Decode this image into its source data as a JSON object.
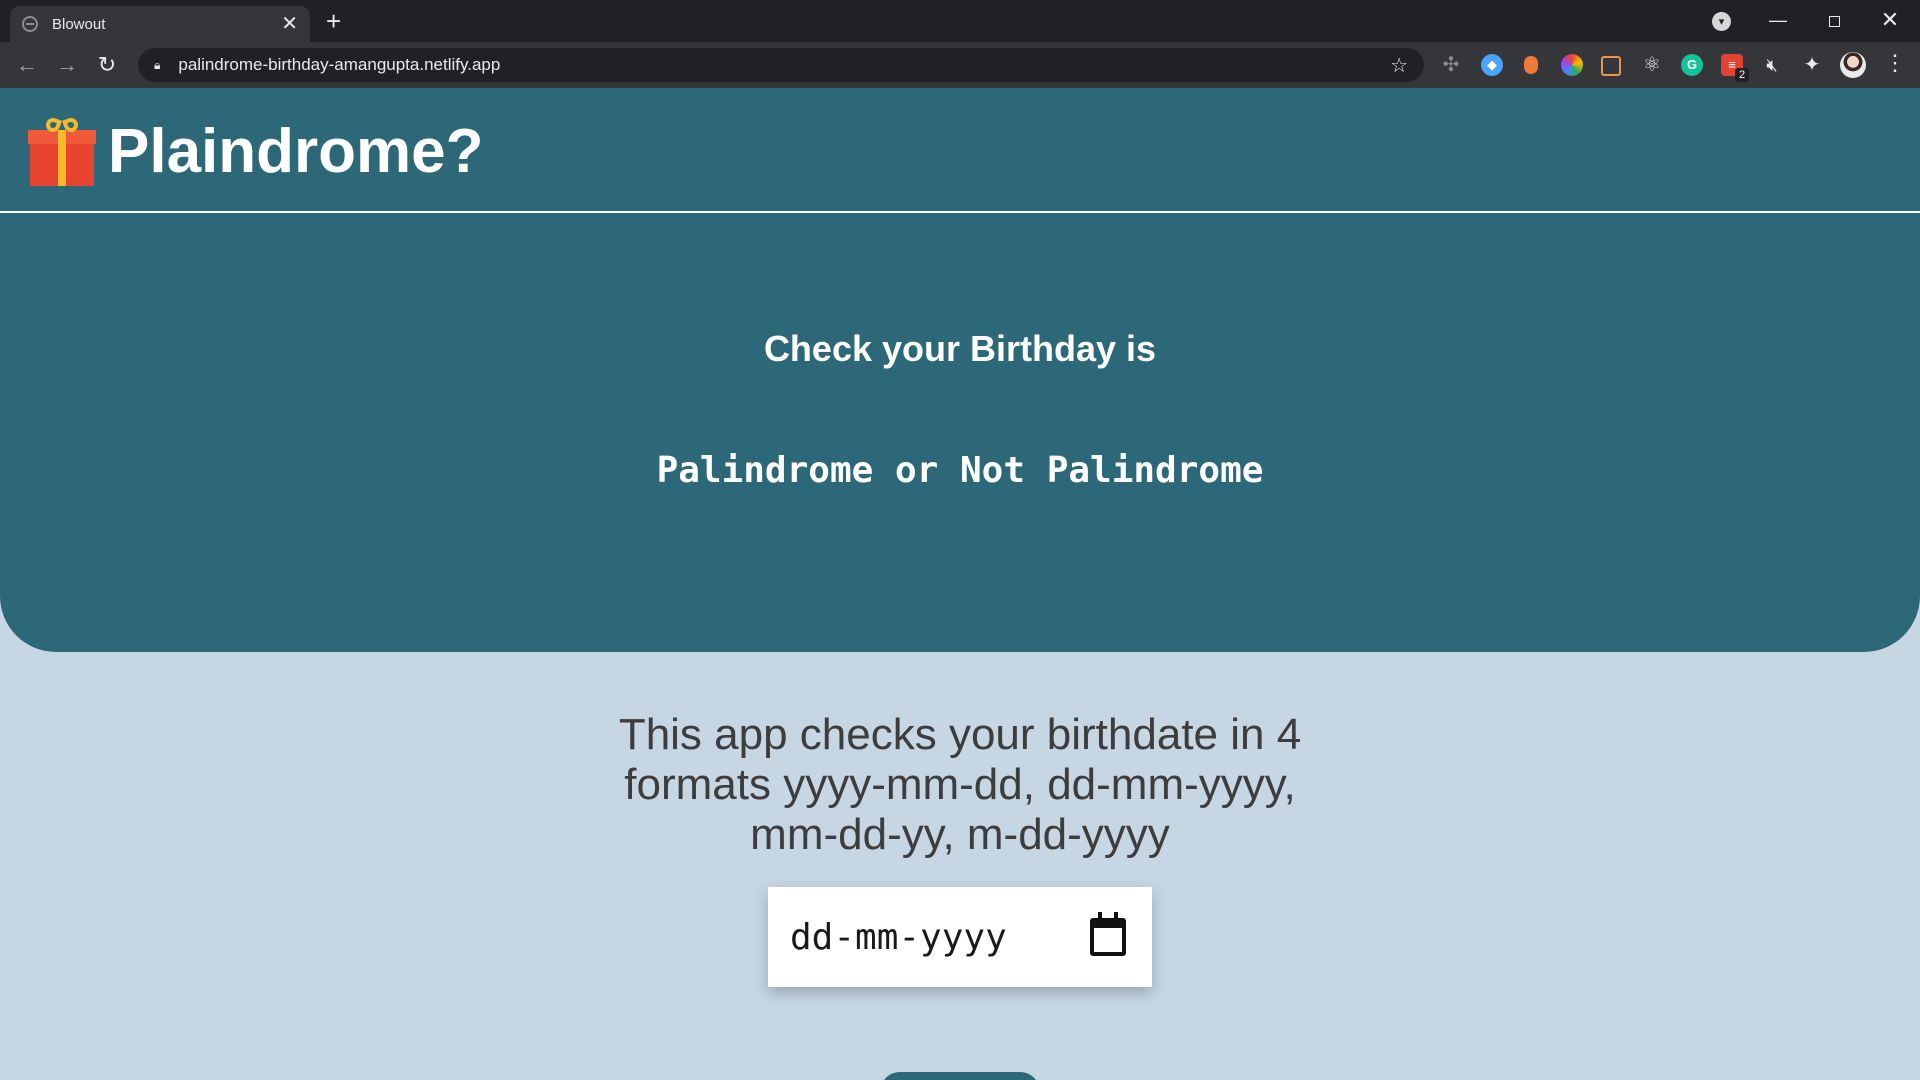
{
  "browser": {
    "tab": {
      "title": "Blowout",
      "close_glyph": "✕",
      "favicon": "globe-icon"
    },
    "new_tab_glyph": "+",
    "url": "palindrome-birthday-amangupta.netlify.app",
    "nav": {
      "back": "←",
      "forward": "→",
      "reload": "↻"
    },
    "star_glyph": "☆",
    "extension_badge": "2",
    "window": {
      "minimize": "—",
      "close": "✕"
    },
    "menu_glyph": "⋮"
  },
  "header": {
    "logo_icon": "gift-icon",
    "title": "Plaindrome?"
  },
  "hero": {
    "heading": "Check your Birthday is",
    "subheading": "Palindrome or Not Palindrome"
  },
  "main": {
    "description": "This app checks your birthdate in 4 formats yyyy-mm-dd, dd-mm-yyyy, mm-dd-yy, m-dd-yyyy",
    "date_input": {
      "placeholder": "dd-mm-yyyy",
      "icon": "calendar-icon"
    }
  },
  "colors": {
    "hero_bg": "#2c6878",
    "page_bg": "#c6d6e3",
    "text_dark": "#3d3d3d"
  }
}
